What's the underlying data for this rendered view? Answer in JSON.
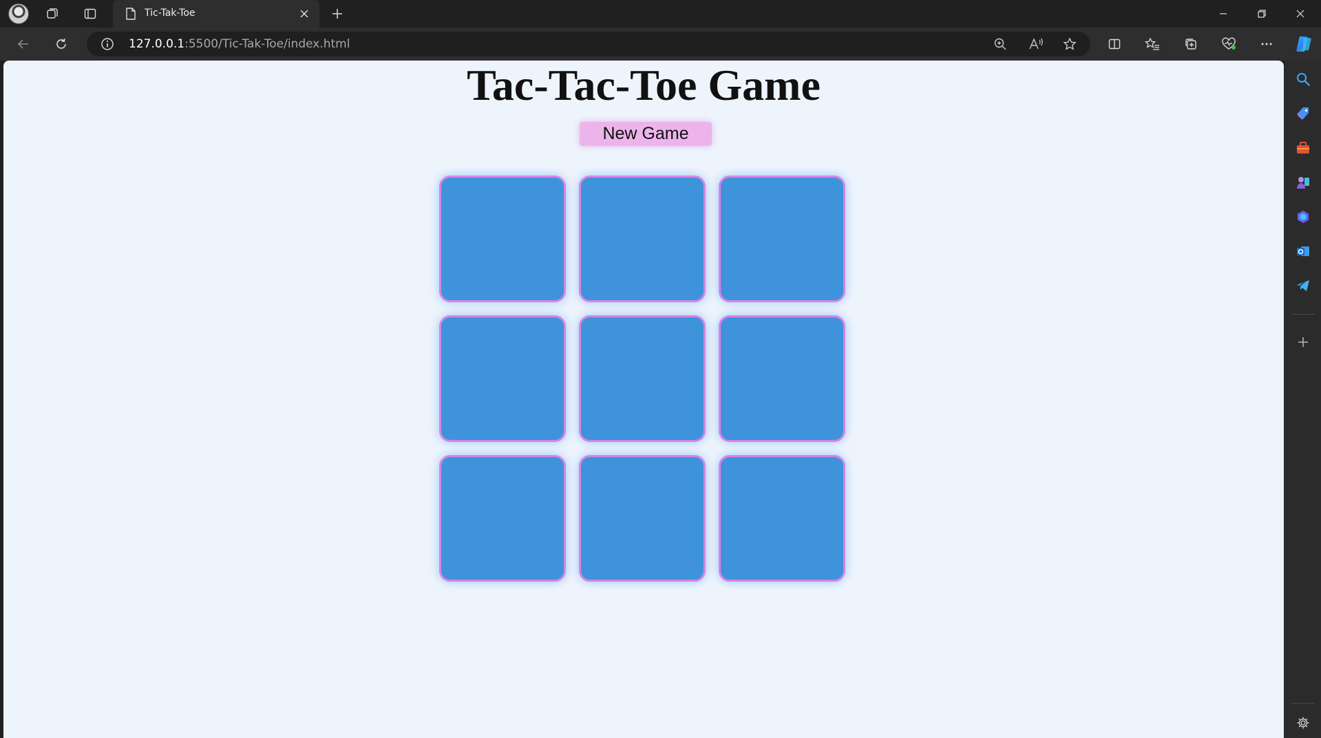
{
  "browser": {
    "tab": {
      "title": "Tic-Tak-Toe"
    },
    "address": {
      "host": "127.0.0.1",
      "path": ":5500/Tic-Tak-Toe/index.html"
    }
  },
  "page": {
    "title": "Tac-Tac-Toe Game",
    "new_game_label": "New Game",
    "board": {
      "cells": [
        "",
        "",
        "",
        "",
        "",
        "",
        "",
        "",
        ""
      ]
    }
  },
  "colors": {
    "page_bg": "#eef4fc",
    "cell_fill": "#3e93db",
    "cell_border": "#d684e6",
    "button_bg": "#ecb4eb"
  }
}
